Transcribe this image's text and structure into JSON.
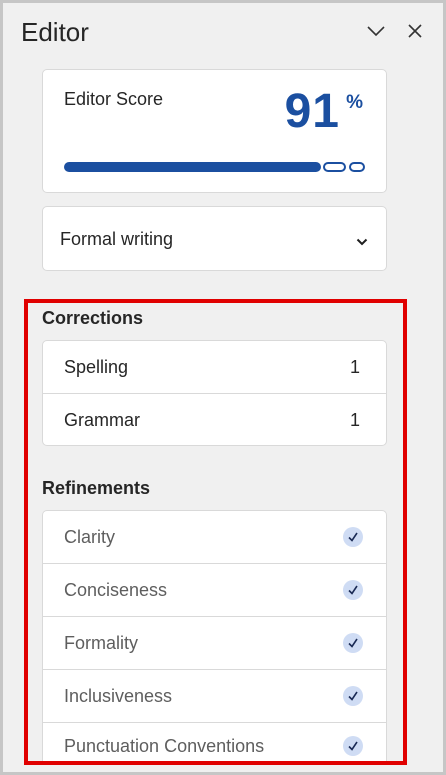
{
  "pane": {
    "title": "Editor"
  },
  "score": {
    "label": "Editor Score",
    "value": "91",
    "unit": "%",
    "progress_percent": 91
  },
  "writing_mode": {
    "selected": "Formal writing"
  },
  "corrections": {
    "title": "Corrections",
    "items": [
      {
        "label": "Spelling",
        "count": "1"
      },
      {
        "label": "Grammar",
        "count": "1"
      }
    ]
  },
  "refinements": {
    "title": "Refinements",
    "items": [
      {
        "label": "Clarity"
      },
      {
        "label": "Conciseness"
      },
      {
        "label": "Formality"
      },
      {
        "label": "Inclusiveness"
      },
      {
        "label": "Punctuation Conventions"
      }
    ]
  },
  "colors": {
    "accent": "#1b4fa0",
    "highlight_border": "#e00000",
    "check_bg": "#cfdcf4"
  }
}
